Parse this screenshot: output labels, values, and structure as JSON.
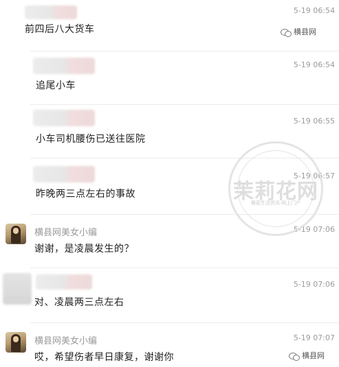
{
  "watermark": {
    "brand_top": "横县网",
    "brand_bottom": "横县网",
    "stamp_text": "茉莉花网",
    "stamp_sub": "横县生活资讯·网上门户"
  },
  "messages": [
    {
      "name": "",
      "time": "5-19 06:54",
      "text": "前四后八大货车"
    },
    {
      "name": "",
      "time": "5-19 06:54",
      "text": "追尾小车"
    },
    {
      "name": "",
      "time": "5-19 06:55",
      "text": "小车司机腰伤已送往医院"
    },
    {
      "name": "",
      "time": "5-19 06:57",
      "text": "昨晚两三点左右的事故"
    },
    {
      "name": "横县网美女小编",
      "time": "5-19 07:06",
      "text": "谢谢，是凌晨发生的？"
    },
    {
      "name": "",
      "time": "5-19 07:06",
      "text": "对、凌晨两三点左右"
    },
    {
      "name": "横县网美女小编",
      "time": "5-19 07:07",
      "text": "哎，希望伤者早日康复，谢谢你"
    }
  ]
}
